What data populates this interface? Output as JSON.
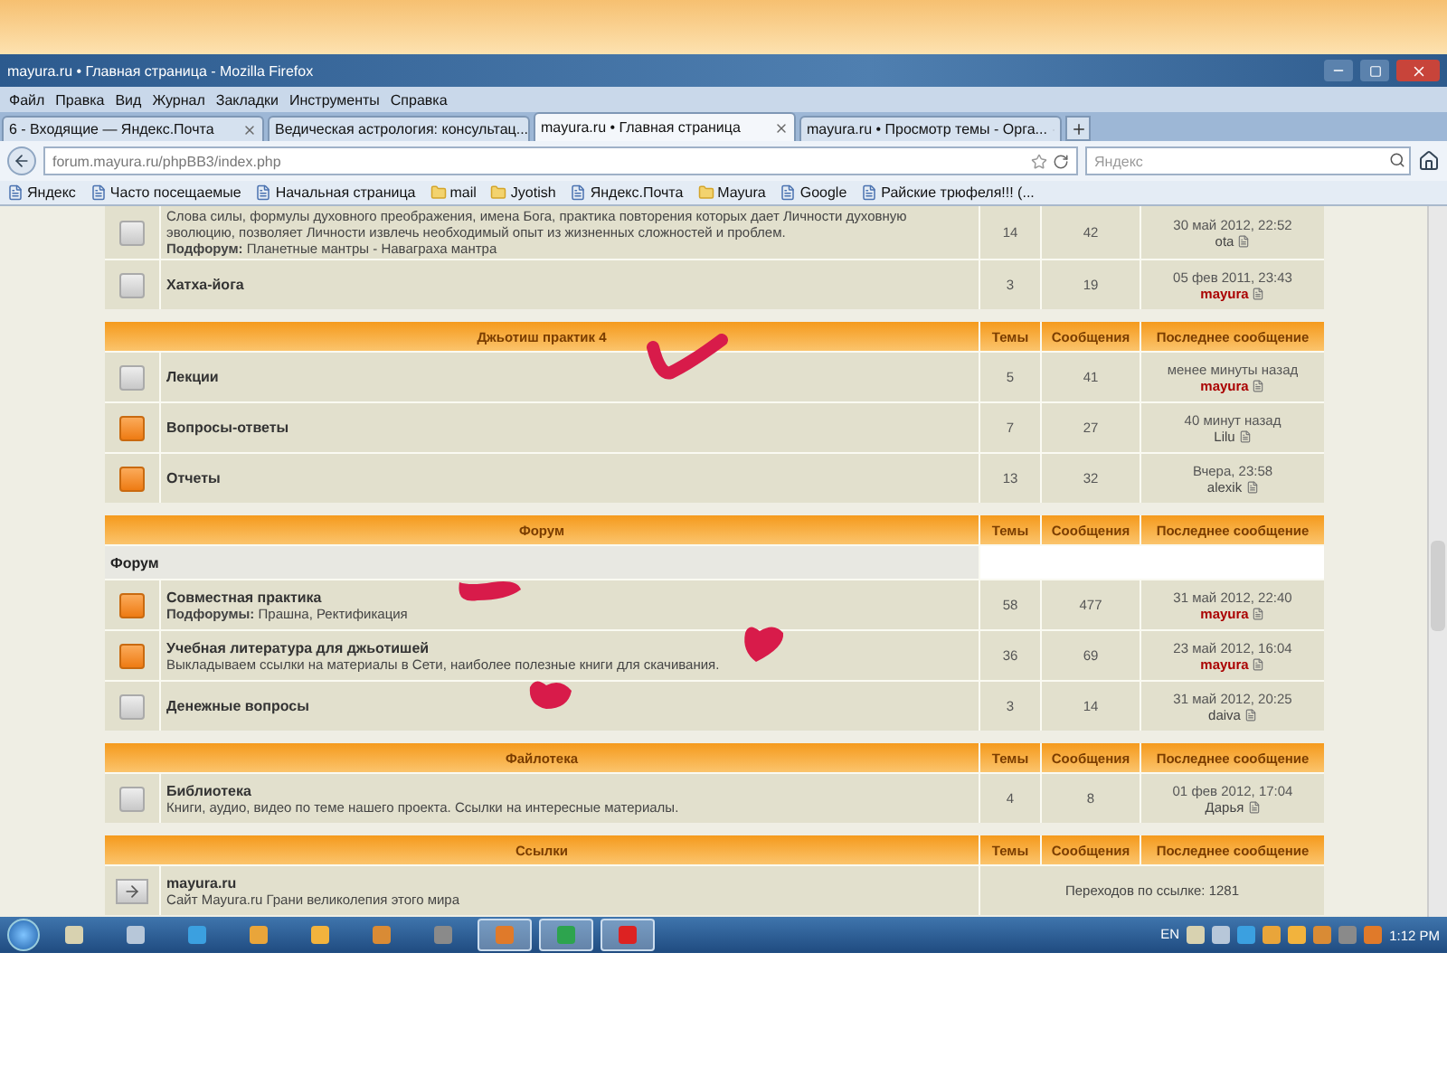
{
  "window": {
    "title": "mayura.ru • Главная страница - Mozilla Firefox"
  },
  "menu": [
    "Файл",
    "Правка",
    "Вид",
    "Журнал",
    "Закладки",
    "Инструменты",
    "Справка"
  ],
  "tabs": [
    {
      "label": "6 - Входящие — Яндекс.Почта",
      "selected": false
    },
    {
      "label": "Ведическая астрология: консультац...",
      "selected": false
    },
    {
      "label": "mayura.ru • Главная страница",
      "selected": true
    },
    {
      "label": "mayura.ru • Просмотр темы - Орга...",
      "selected": false
    }
  ],
  "address": {
    "url": "forum.mayura.ru/phpBB3/index.php"
  },
  "search": {
    "placeholder": "Яндекс"
  },
  "bookmarks": [
    {
      "label": "Яндекс",
      "kind": "page"
    },
    {
      "label": "Часто посещаемые",
      "kind": "page"
    },
    {
      "label": "Начальная страница",
      "kind": "page"
    },
    {
      "label": "mail",
      "kind": "folder"
    },
    {
      "label": "Jyotish",
      "kind": "folder"
    },
    {
      "label": "Яндекс.Почта",
      "kind": "page"
    },
    {
      "label": "Mayura",
      "kind": "folder"
    },
    {
      "label": "Google",
      "kind": "page"
    },
    {
      "label": "Райские трюфеля!!! (...",
      "kind": "page"
    }
  ],
  "sections": [
    {
      "rows": [
        {
          "kind": "forum",
          "unread": false,
          "description": "Слова силы, формулы духовного преображения, имена Бога, практика повторения которых дает Личности духовную эволюцию, позволяет Личности извлечь необходимый опыт из жизненных сложностей и проблем.",
          "subforums": "**Подфорум:** Планетные мантры - Наваграха мантра",
          "topics": "14",
          "posts": "42",
          "last_time": "30 май 2012, 22:52",
          "last_author": "ota",
          "author_highlighted": false
        },
        {
          "kind": "forum",
          "unread": false,
          "title": "Хатха-йога",
          "topics": "3",
          "posts": "19",
          "last_time": "05 фев 2011, 23:43",
          "last_author": "mayura",
          "author_highlighted": true
        }
      ]
    },
    {
      "title": "Джьотиш практик 4",
      "columns": [
        "Темы",
        "Сообщения",
        "Последнее сообщение"
      ],
      "rows": [
        {
          "kind": "forum",
          "unread": false,
          "title": "Лекции",
          "topics": "5",
          "posts": "41",
          "last_time": "менее минуты назад",
          "last_author": "mayura",
          "author_highlighted": true
        },
        {
          "kind": "forum",
          "unread": true,
          "title": "Вопросы-ответы",
          "topics": "7",
          "posts": "27",
          "last_time": "40 минут назад",
          "last_author": "Lilu",
          "author_highlighted": false
        },
        {
          "kind": "forum",
          "unread": true,
          "title": "Отчеты",
          "topics": "13",
          "posts": "32",
          "last_time": "Вчера, 23:58",
          "last_author": "alexik",
          "author_highlighted": false
        }
      ]
    },
    {
      "title": "Форум",
      "columns": [
        "Темы",
        "Сообщения",
        "Последнее сообщение"
      ],
      "rows": [
        {
          "kind": "category",
          "title": "Форум"
        },
        {
          "kind": "forum",
          "unread": true,
          "title": "Совместная практика",
          "subforums": "**Подфорумы:** Прашна, Ректификация",
          "topics": "58",
          "posts": "477",
          "last_time": "31 май 2012, 22:40",
          "last_author": "mayura",
          "author_highlighted": true
        },
        {
          "kind": "forum",
          "unread": true,
          "title": "Учебная литература для джьотишей",
          "description": "Выкладываем ссылки на материалы в Сети, наиболее полезные книги для скачивания.",
          "topics": "36",
          "posts": "69",
          "last_time": "23 май 2012, 16:04",
          "last_author": "mayura",
          "author_highlighted": true
        },
        {
          "kind": "forum",
          "unread": false,
          "title": "Денежные вопросы",
          "topics": "3",
          "posts": "14",
          "last_time": "31 май 2012, 20:25",
          "last_author": "daiva",
          "author_highlighted": false
        }
      ]
    },
    {
      "title": "Файлотека",
      "columns": [
        "Темы",
        "Сообщения",
        "Последнее сообщение"
      ],
      "rows": [
        {
          "kind": "forum",
          "unread": false,
          "title": "Библиотека",
          "description": "Книги, аудио, видео по теме нашего проекта. Ссылки на интересные материалы.",
          "topics": "4",
          "posts": "8",
          "last_time": "01 фев 2012, 17:04",
          "last_author": "Дарья",
          "author_highlighted": false
        }
      ]
    },
    {
      "title": "Ссылки",
      "columns": [
        "Темы",
        "Сообщения",
        "Последнее сообщение"
      ],
      "rows": [
        {
          "kind": "link",
          "title": "mayura.ru",
          "description": "Сайт Mayura.ru Грани великолепия этого мира",
          "redirects": "Переходов по ссылке: 1281"
        }
      ]
    }
  ],
  "taskbar": {
    "apps": [
      {
        "running": false
      },
      {
        "running": false
      },
      {
        "running": false
      },
      {
        "running": false
      },
      {
        "running": false
      },
      {
        "running": false
      },
      {
        "running": false
      },
      {
        "running": true
      },
      {
        "running": true
      },
      {
        "running": true
      }
    ],
    "language": "EN",
    "clock": "1:12 PM"
  }
}
